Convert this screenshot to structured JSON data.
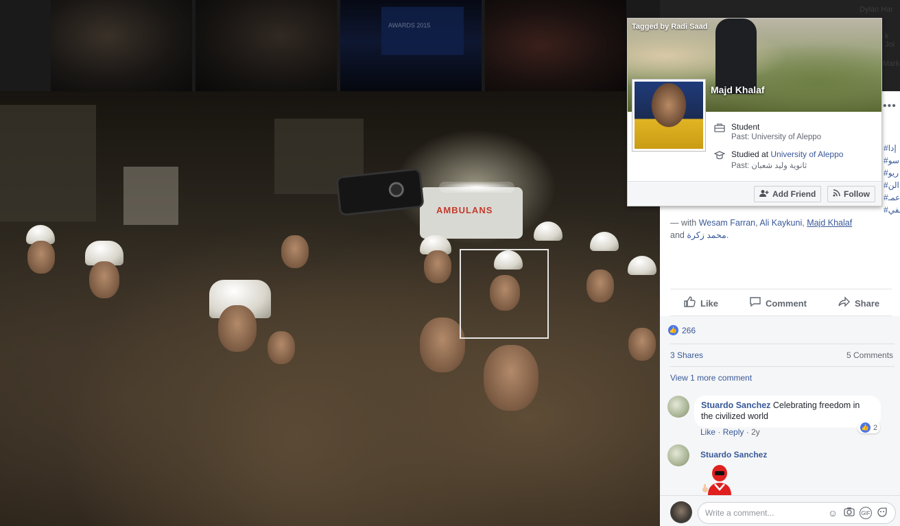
{
  "hovercard": {
    "tagged_by": "Tagged by Radi Saad",
    "name": "Majd Khalaf",
    "work_title": "Student",
    "work_past": "Past: University of Aleppo",
    "study_prefix": "Studied at ",
    "study_school": "University of Aleppo",
    "study_past": "Past: ثانوية وليد شعبان",
    "add_friend": "Add Friend",
    "follow": "Follow"
  },
  "photo": {
    "ambulance_text": "AMBULANS",
    "screen_text": "AWARDS 2015"
  },
  "sidebar_ghost": [
    "Dylan Har",
    "k Joi",
    "Mark"
  ],
  "post": {
    "more": "•••",
    "hashtags": [
      "#إدا",
      "#سو",
      "#ريو",
      "#الن",
      "#عمـ",
      "#سيلفي"
    ],
    "with_prefix": "— with ",
    "tag1": "Wesam Farran",
    "sep1": ", ",
    "tag2": "Ali Kaykuni",
    "sep2": ", ",
    "tag3": "Majd Khalaf",
    "and": "and ",
    "tag4": "محمد زكرة",
    "end": "."
  },
  "actions": {
    "like": "Like",
    "comment": "Comment",
    "share": "Share"
  },
  "reactions": {
    "count": "266",
    "shares": "3 Shares",
    "comments": "5 Comments",
    "view_more": "View 1 more comment"
  },
  "comments": [
    {
      "author": "Stuardo Sanchez",
      "text": "Celebrating freedom in the civilized world",
      "like": "Like",
      "reply": "Reply",
      "age": "2y",
      "reactions": "2"
    },
    {
      "author": "Stuardo Sanchez"
    }
  ],
  "composer": {
    "placeholder": "Write a comment...",
    "gif": "GIF"
  },
  "colors": {
    "link": "#385898",
    "like_blue": "#4a76e8"
  }
}
